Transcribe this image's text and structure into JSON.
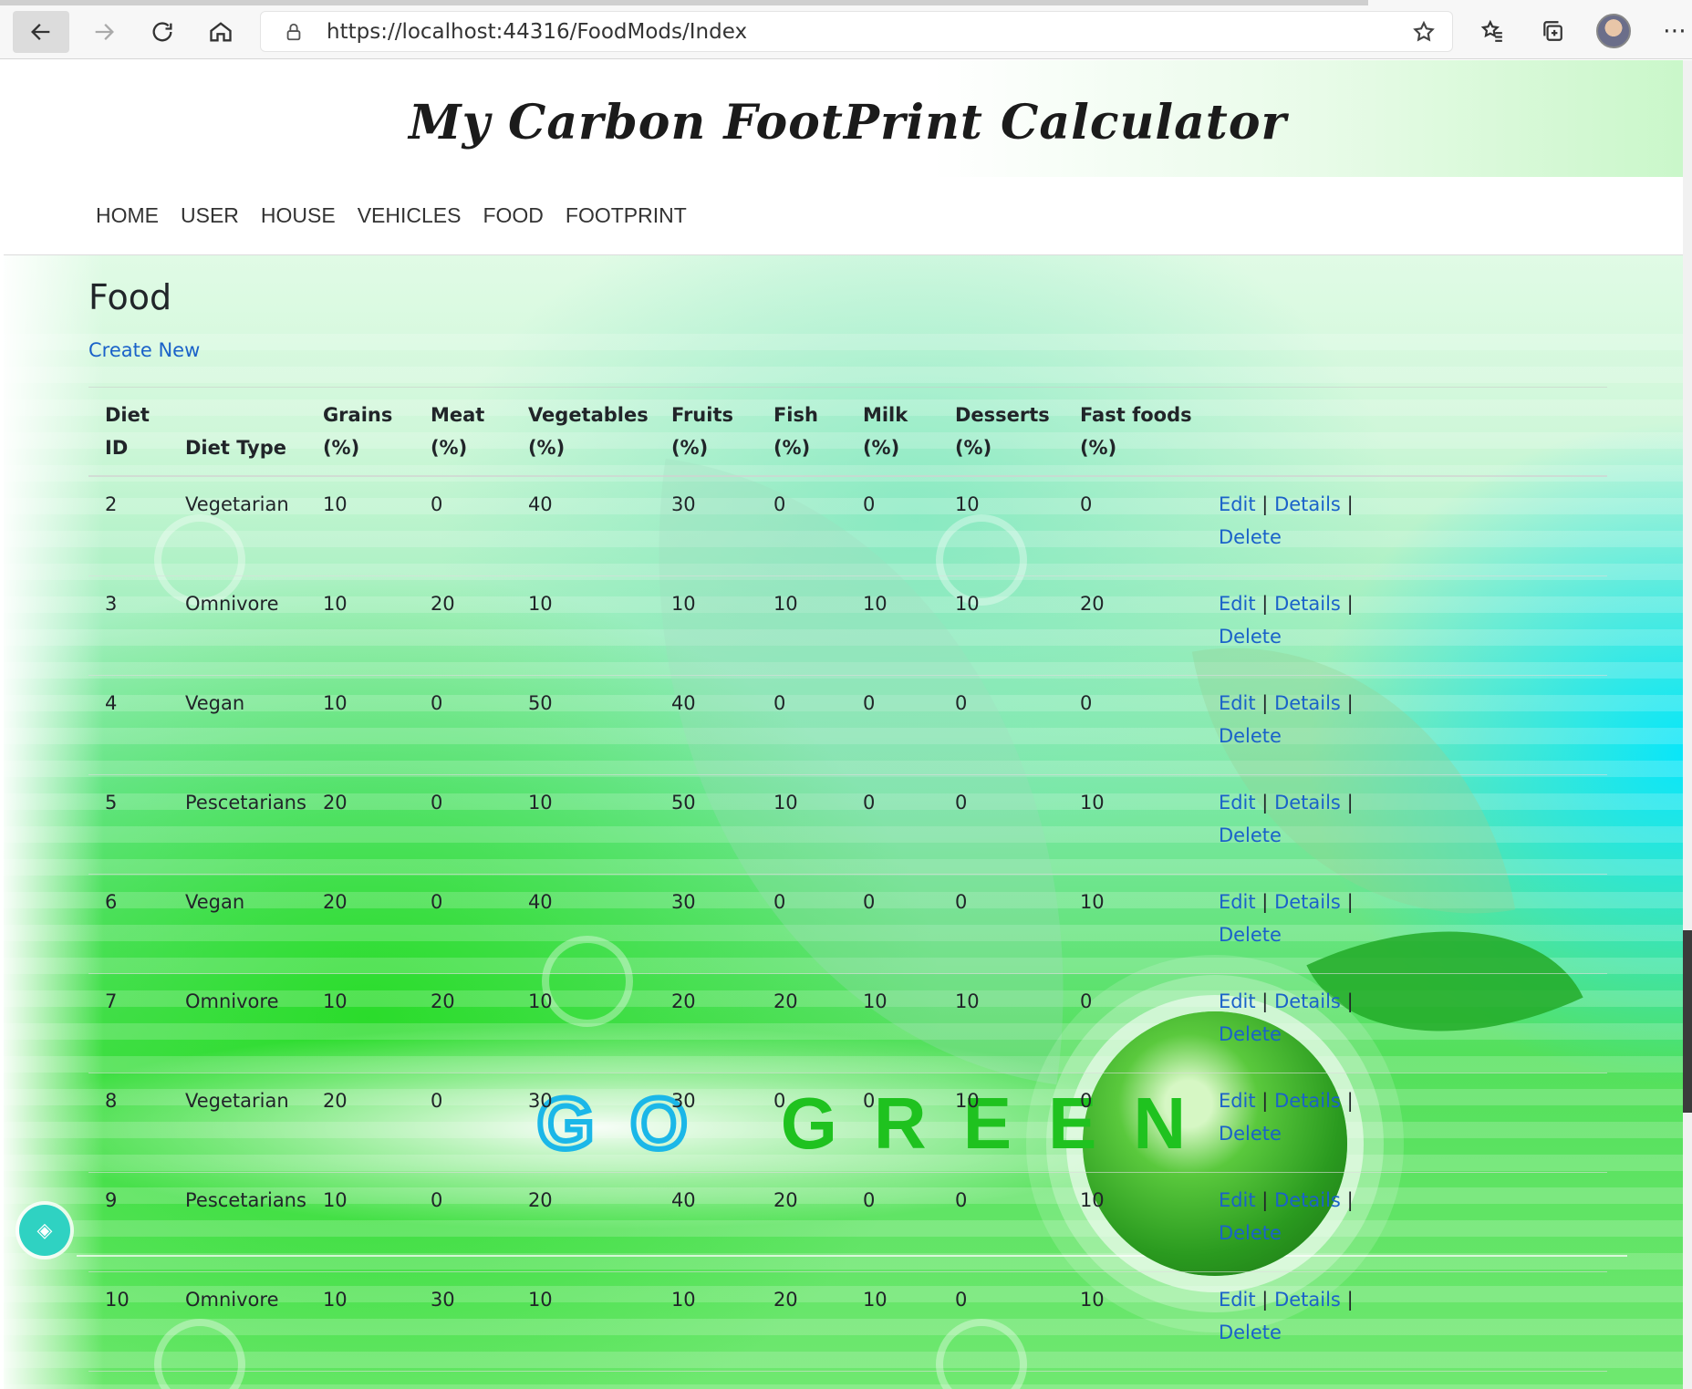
{
  "browser": {
    "url": "https://localhost:44316/FoodMods/Index",
    "url_plain": "https://localhost",
    "url_port_path": ":44316/FoodMods/Index"
  },
  "site": {
    "title": "My Carbon FootPrint Calculator"
  },
  "nav": {
    "items": [
      "HOME",
      "USER",
      "HOUSE",
      "VEHICLES",
      "FOOD",
      "FOOTPRINT"
    ]
  },
  "page": {
    "title": "Food",
    "create_new": "Create New"
  },
  "table": {
    "headers": [
      [
        "Diet",
        "ID"
      ],
      [
        "",
        "Diet Type"
      ],
      [
        "Grains",
        "(%)"
      ],
      [
        "Meat",
        "(%)"
      ],
      [
        "Vegetables",
        "(%)"
      ],
      [
        "Fruits",
        "(%)"
      ],
      [
        "Fish",
        "(%)"
      ],
      [
        "Milk",
        "(%)"
      ],
      [
        "Desserts",
        "(%)"
      ],
      [
        "Fast foods",
        "(%)"
      ]
    ],
    "actions": {
      "edit": "Edit",
      "details": "Details",
      "delete": "Delete",
      "separator": "|"
    },
    "rows": [
      [
        "2",
        "Vegetarian",
        "10",
        "0",
        "40",
        "30",
        "0",
        "0",
        "10",
        "0"
      ],
      [
        "3",
        "Omnivore",
        "10",
        "20",
        "10",
        "10",
        "10",
        "10",
        "10",
        "20"
      ],
      [
        "4",
        "Vegan",
        "10",
        "0",
        "50",
        "40",
        "0",
        "0",
        "0",
        "0"
      ],
      [
        "5",
        "Pescetarians",
        "20",
        "0",
        "10",
        "50",
        "10",
        "0",
        "0",
        "10"
      ],
      [
        "6",
        "Vegan",
        "20",
        "0",
        "40",
        "30",
        "0",
        "0",
        "0",
        "10"
      ],
      [
        "7",
        "Omnivore",
        "10",
        "20",
        "10",
        "20",
        "20",
        "10",
        "10",
        "0"
      ],
      [
        "8",
        "Vegetarian",
        "20",
        "0",
        "30",
        "30",
        "0",
        "0",
        "10",
        "0"
      ],
      [
        "9",
        "Pescetarians",
        "10",
        "0",
        "20",
        "40",
        "20",
        "0",
        "0",
        "10"
      ],
      [
        "10",
        "Omnivore",
        "10",
        "30",
        "10",
        "10",
        "20",
        "10",
        "0",
        "10"
      ]
    ]
  },
  "background_text": {
    "go": "GO",
    "green": "GREEN"
  },
  "colors": {
    "link": "#1a62c9",
    "text": "#212529",
    "accent_green": "#1fc21f",
    "accent_cyan": "#1bb7e8"
  },
  "icons": [
    "back-icon",
    "forward-icon",
    "reload-icon",
    "home-icon",
    "lock-icon",
    "add-favorite-icon",
    "favorites-icon",
    "collections-icon",
    "more-icon"
  ]
}
